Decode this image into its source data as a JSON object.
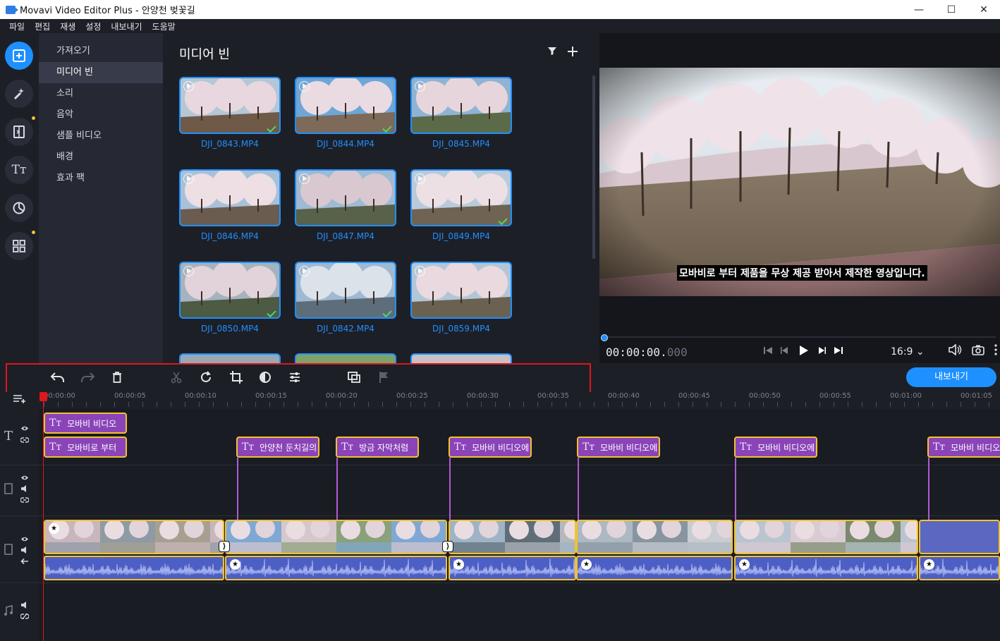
{
  "window": {
    "title": "Movavi Video Editor Plus - 안양천 벚꽃길",
    "minimize": "—",
    "maximize": "☐",
    "close": "✕"
  },
  "menu": [
    "파일",
    "편집",
    "재생",
    "설정",
    "내보내기",
    "도움말"
  ],
  "rail": [
    {
      "icon": "import-icon",
      "active": true,
      "dot": false
    },
    {
      "icon": "magic-wand-icon",
      "active": false,
      "dot": false
    },
    {
      "icon": "transitions-icon",
      "active": false,
      "dot": true
    },
    {
      "icon": "titles-icon",
      "active": false,
      "dot": false
    },
    {
      "icon": "stickers-icon",
      "active": false,
      "dot": false
    },
    {
      "icon": "more-tools-icon",
      "active": false,
      "dot": true
    }
  ],
  "categories": [
    "가져오기",
    "미디어 빈",
    "소리",
    "음악",
    "샘플 비디오",
    "배경",
    "효과 팩"
  ],
  "bin": {
    "title": "미디어 빈",
    "files": [
      {
        "name": "DJI_0843.MP4",
        "checked": true
      },
      {
        "name": "DJI_0844.MP4",
        "checked": true
      },
      {
        "name": "DJI_0845.MP4",
        "checked": false
      },
      {
        "name": "DJI_0846.MP4",
        "checked": false
      },
      {
        "name": "DJI_0847.MP4",
        "checked": false
      },
      {
        "name": "DJI_0849.MP4",
        "checked": true
      },
      {
        "name": "DJI_0850.MP4",
        "checked": true
      },
      {
        "name": "DJI_0842.MP4",
        "checked": true
      },
      {
        "name": "DJI_0859.MP4",
        "checked": false
      }
    ]
  },
  "preview": {
    "subtitle": "모바비로 부터 제품을 무상 제공 받아서 제작한 영상입니다.",
    "time_main": "00:00:00.",
    "time_ms": "000",
    "aspect": "16:9 ⌄"
  },
  "toolbar": {
    "export_label": "내보내기"
  },
  "timeline": {
    "ruler": [
      "00:00:00",
      "00:00:05",
      "00:00:10",
      "00:00:15",
      "00:00:20",
      "00:00:25",
      "00:00:30",
      "00:00:35",
      "00:00:40",
      "00:00:45",
      "00:00:50",
      "00:00:55",
      "00:01:00",
      "00:01:05"
    ],
    "title_clips_row1": [
      "모바비 비디오"
    ],
    "title_clips_row2": [
      "모바비로 부터",
      "안양천 둔치길의",
      "방금 자막처럼",
      "모바비 비디오에",
      "모바비 비디오에",
      "모바비 비디오에",
      "모바비 비디오"
    ],
    "title_glyph": "Tт",
    "star": "★",
    "transition": "⟩"
  }
}
